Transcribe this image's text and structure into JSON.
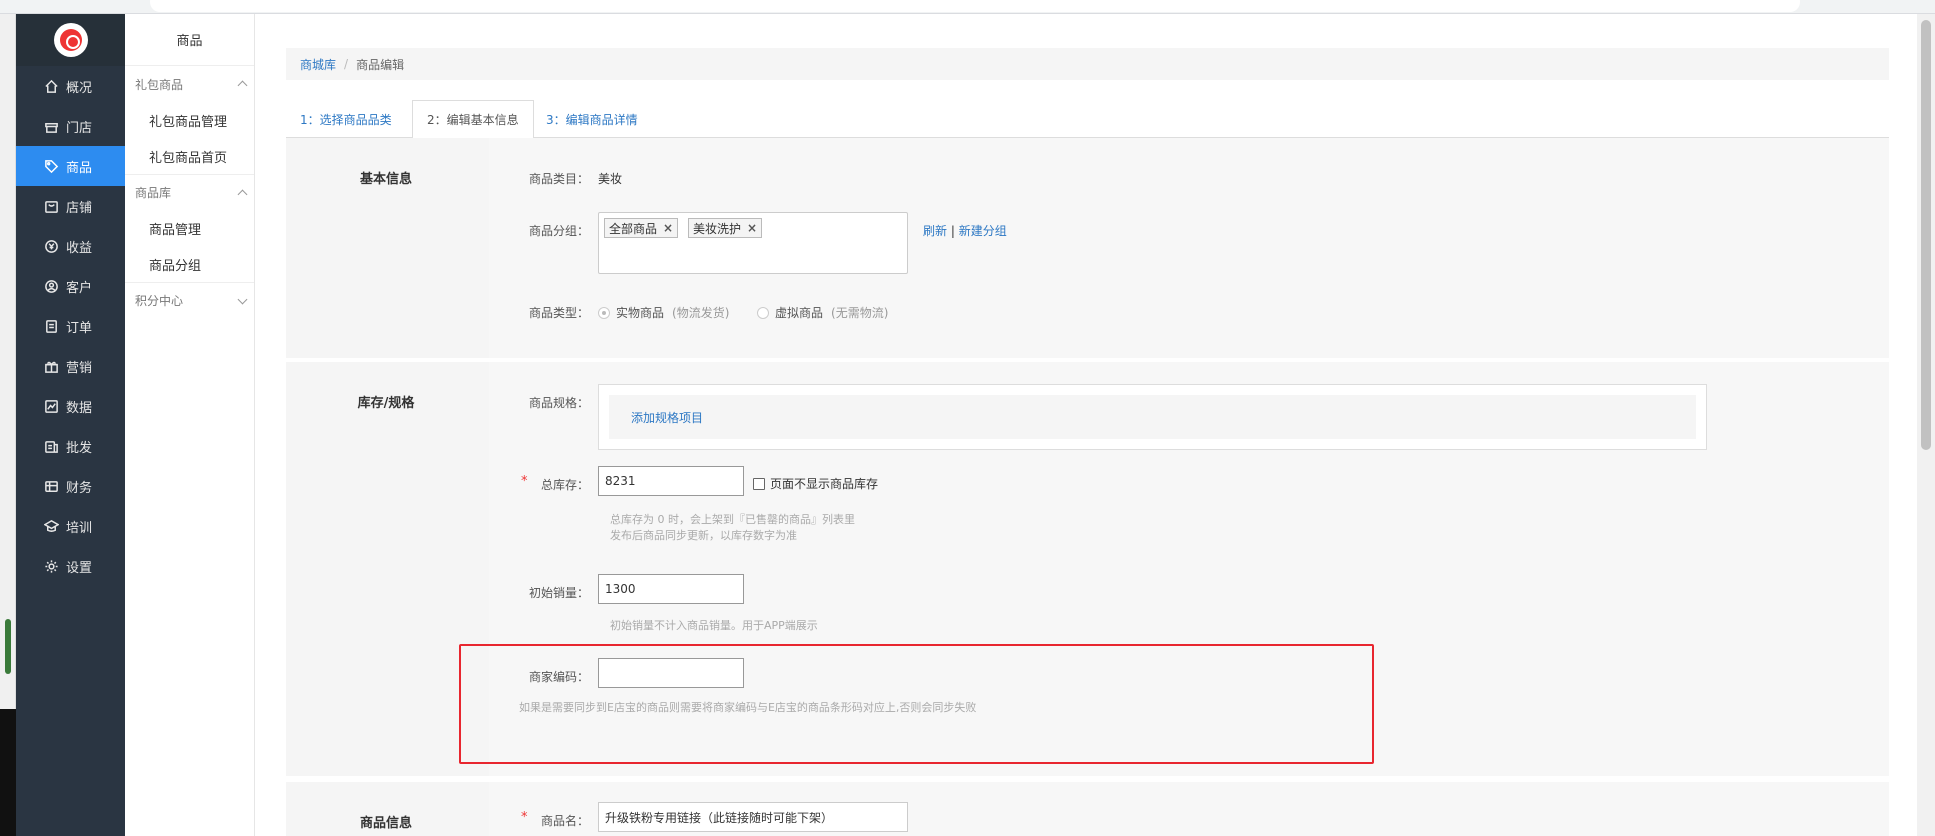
{
  "sidebar": {
    "items": [
      {
        "label": "概况",
        "icon": "home-icon",
        "active": false
      },
      {
        "label": "门店",
        "icon": "store-icon",
        "active": false
      },
      {
        "label": "商品",
        "icon": "tag-icon",
        "active": true
      },
      {
        "label": "店铺",
        "icon": "shop-icon",
        "active": false
      },
      {
        "label": "收益",
        "icon": "yen-icon",
        "active": false
      },
      {
        "label": "客户",
        "icon": "user-icon",
        "active": false
      },
      {
        "label": "订单",
        "icon": "order-icon",
        "active": false
      },
      {
        "label": "营销",
        "icon": "gift-icon",
        "active": false
      },
      {
        "label": "数据",
        "icon": "chart-icon",
        "active": false
      },
      {
        "label": "批发",
        "icon": "wholesale-icon",
        "active": false
      },
      {
        "label": "财务",
        "icon": "finance-icon",
        "active": false
      },
      {
        "label": "培训",
        "icon": "training-icon",
        "active": false
      },
      {
        "label": "设置",
        "icon": "gear-icon",
        "active": false
      }
    ],
    "accent": "#2d8cf0",
    "bg": "#2a3542"
  },
  "subnav": {
    "title": "商品",
    "group1": "礼包商品",
    "group1_items": [
      "礼包商品管理",
      "礼包商品首页"
    ],
    "group2": "商品库",
    "group2_items": [
      "商品管理",
      "商品分组"
    ],
    "group3": "积分中心"
  },
  "breadcrumb": {
    "root": "商城库",
    "sep": "/",
    "current": "商品编辑"
  },
  "tabs": [
    "1：选择商品品类",
    "2：编辑基本信息",
    "3：编辑商品详情"
  ],
  "basic": {
    "title": "基本信息",
    "category_label": "商品类目：",
    "category_value": "美妆",
    "group_label": "商品分组：",
    "group_tags": [
      "全部商品",
      "美妆洗护"
    ],
    "refresh": "刷新",
    "bar": "|",
    "new_group": "新建分组",
    "type_label": "商品类型：",
    "type_physical": "实物商品",
    "type_physical_sub": "(物流发货)",
    "type_virtual": "虚拟商品",
    "type_virtual_sub": "(无需物流)"
  },
  "stock": {
    "title": "库存/规格",
    "spec_label": "商品规格：",
    "add_spec": "添加规格项目",
    "total_label": "总库存：",
    "total_value": "8231",
    "hide_stock": "页面不显示商品库存",
    "total_hint1": "总库存为 0 时，会上架到『已售罄的商品』列表里",
    "total_hint2": "发布后商品同步更新，以库存数字为准",
    "init_label": "初始销量：",
    "init_value": "1300",
    "init_hint": "初始销量不计入商品销量。用于APP端展示",
    "merchant_label": "商家编码：",
    "merchant_value": "",
    "merchant_hint": "如果是需要同步到E店宝的商品则需要将商家编码与E店宝的商品条形码对应上,否则会同步失败"
  },
  "product": {
    "title": "商品信息",
    "name_label": "商品名：",
    "name_value": "升级铁粉专用链接（此链接随时可能下架）"
  },
  "required_mark": "*",
  "highlight_color": "#e8262f"
}
